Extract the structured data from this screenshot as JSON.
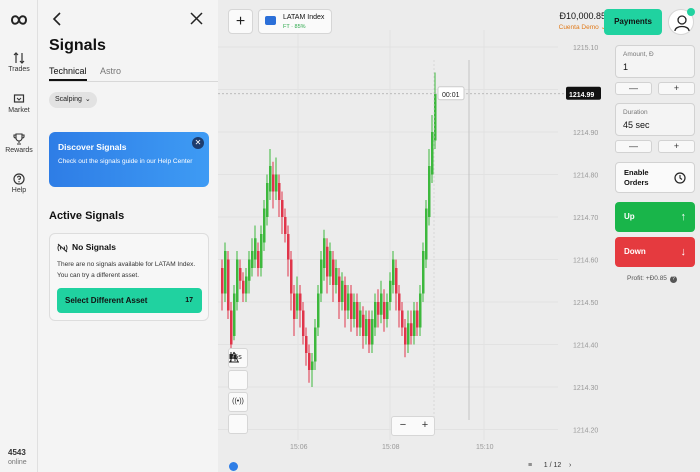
{
  "rail": {
    "items": [
      {
        "label": "Trades",
        "icon": "arrows-updown-icon"
      },
      {
        "label": "Market",
        "icon": "cart-icon"
      },
      {
        "label": "Rewards",
        "icon": "trophy-icon"
      },
      {
        "label": "Help",
        "icon": "help-icon"
      }
    ],
    "online_count": "4543",
    "online_label": "online"
  },
  "signals": {
    "title": "Signals",
    "tabs": [
      "Technical",
      "Astro"
    ],
    "filter": "Scalping",
    "banner": {
      "title": "Discover Signals",
      "text": "Check out the signals guide in our Help Center"
    },
    "section_title": "Active Signals",
    "empty": {
      "title": "No Signals",
      "text": "There are no signals available for LATAM Index. You can try a different asset.",
      "button": "Select Different Asset",
      "count": "17"
    }
  },
  "chart": {
    "asset_name": "LATAM Index",
    "asset_payout": "FT · 85%",
    "price_labels": [
      "1215.10",
      "1215.00",
      "1214.90",
      "1214.80",
      "1214.70",
      "1214.60",
      "1214.50",
      "1214.40",
      "1214.30",
      "1214.20"
    ],
    "time_labels": [
      "15:06",
      "15:08",
      "15:10"
    ],
    "current_price": "1214.99",
    "timer": "00:01",
    "timeframe": "5s",
    "pager": "1 / 12",
    "colors": {
      "up": "#3db83d",
      "down": "#e0354a"
    }
  },
  "trade": {
    "balance": "Đ10,000.85",
    "account": "Cuenta Demo",
    "payments": "Payments",
    "amount_label": "Amount, Đ",
    "amount_value": "1",
    "duration_label": "Duration",
    "duration_value": "45 sec",
    "minus": "—",
    "plus": "+",
    "enable_orders": "Enable Orders",
    "up": "Up",
    "down": "Down",
    "profit": "Profit: +Đ0.85"
  }
}
